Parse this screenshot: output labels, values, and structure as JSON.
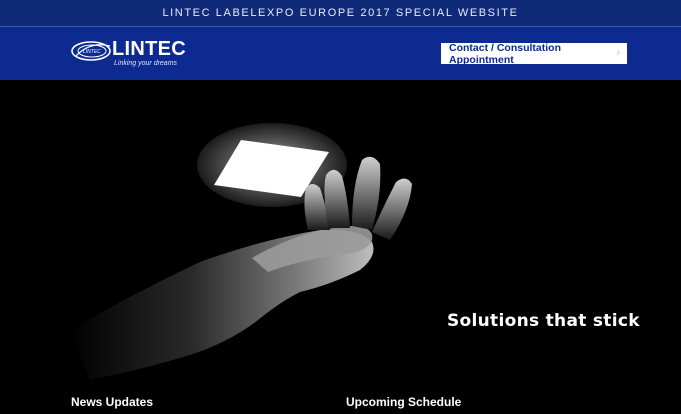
{
  "topbar": {
    "title": "LINTEC LABELEXPO EUROPE 2017 SPECIAL WEBSITE"
  },
  "header": {
    "logo_text": "LINTEC",
    "logo_mark_text": "LINTEC",
    "logo_tagline": "Linking your dreams",
    "contact_label": "Contact / Consultation Appointment",
    "contact_chevron": "›"
  },
  "hero": {
    "tagline": "Solutions that stick"
  },
  "sections": {
    "news_title": "News Updates",
    "schedule_title": "Upcoming Schedule"
  },
  "colors": {
    "topbar_bg": "#0f2a78",
    "header_bg": "#0c2a8f",
    "hero_bg": "#000000",
    "button_bg": "#ffffff",
    "button_text": "#0c2a8f"
  }
}
